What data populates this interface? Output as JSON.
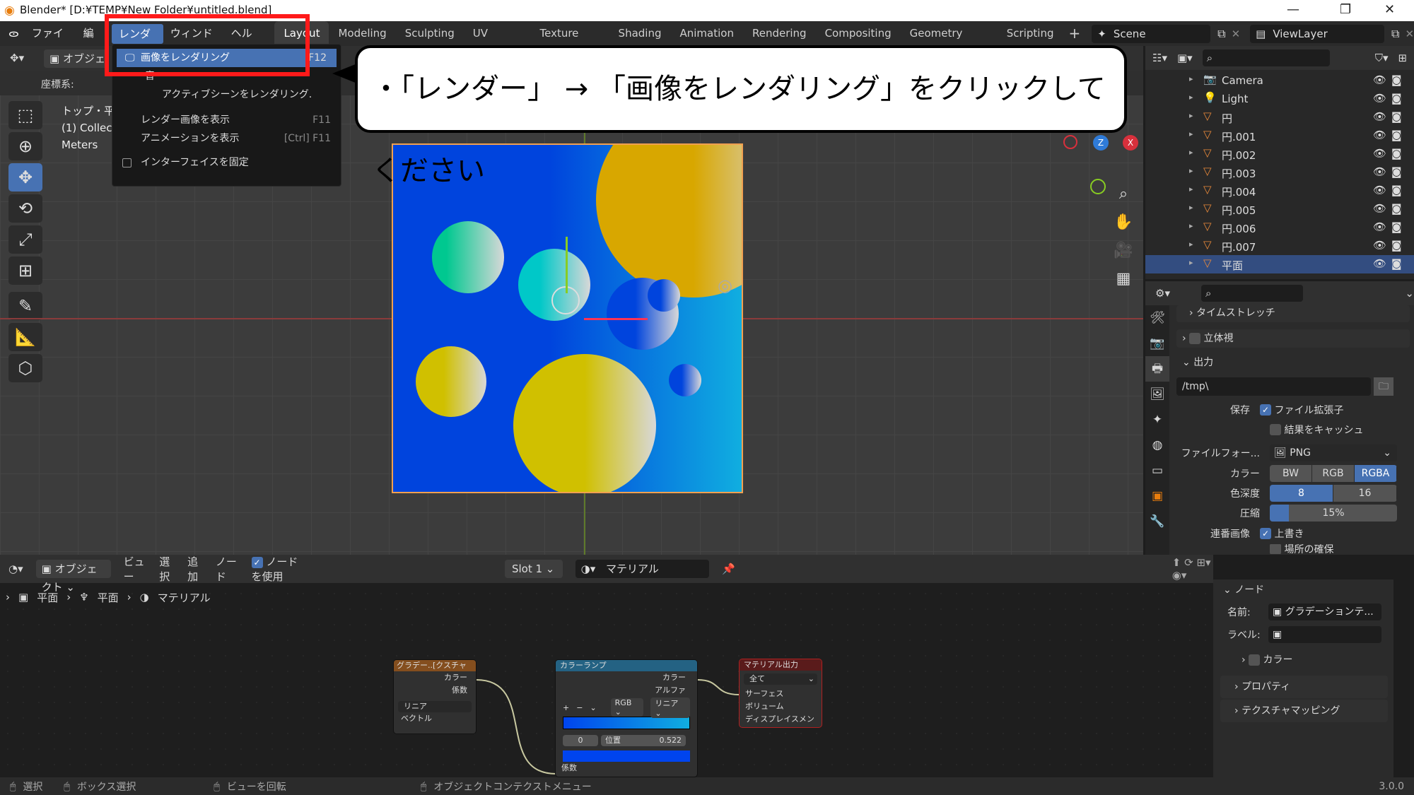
{
  "window": {
    "title": "Blender* [D:¥TEMP¥New Folder¥untitled.blend]"
  },
  "menubar": {
    "items": [
      "ファイル",
      "編集",
      "レンダー",
      "ウィンドウ",
      "ヘルプ"
    ]
  },
  "workspaces": [
    "Layout",
    "Modeling",
    "Sculpting",
    "UV Editing",
    "Texture Paint",
    "Shading",
    "Animation",
    "Rendering",
    "Compositing",
    "Geometry Nodes",
    "Scripting"
  ],
  "active_workspace": "Layout",
  "scene": "Scene",
  "view_layer": "ViewLayer",
  "render_menu": {
    "items": [
      {
        "label": "画像をレンダリング",
        "shortcut": "F12"
      },
      {
        "label": "アクティブシーンをレンダリング."
      },
      {
        "label": "レンダー画像を表示",
        "shortcut": "F11"
      },
      {
        "label": "アニメーションを表示",
        "shortcut": "[Ctrl] F11"
      },
      {
        "label": "インターフェイスを固定"
      }
    ],
    "partial": "音"
  },
  "callout": {
    "text": "・「レンダー」 → 「画像をレンダリング」をクリックしてください"
  },
  "viewport": {
    "header_mode": "オブジェ",
    "coord_label": "座標系:",
    "info": [
      "トップ・平",
      "(1) Collecti",
      "Meters"
    ],
    "colors": {
      "bg_plane_left": "#0044dd",
      "bg_plane_right": "#10aee0",
      "accent": "#4772b3"
    }
  },
  "outliner": {
    "items": [
      {
        "name": "Camera",
        "icon": "camera-icon"
      },
      {
        "name": "Light",
        "icon": "light-icon"
      },
      {
        "name": "円",
        "icon": "mesh-icon"
      },
      {
        "name": "円.001",
        "icon": "mesh-icon"
      },
      {
        "name": "円.002",
        "icon": "mesh-icon"
      },
      {
        "name": "円.003",
        "icon": "mesh-icon"
      },
      {
        "name": "円.004",
        "icon": "mesh-icon"
      },
      {
        "name": "円.005",
        "icon": "mesh-icon"
      },
      {
        "name": "円.006",
        "icon": "mesh-icon"
      },
      {
        "name": "円.007",
        "icon": "mesh-icon"
      },
      {
        "name": "平面",
        "icon": "mesh-icon",
        "selected": true
      }
    ]
  },
  "properties": {
    "sections": {
      "timestretch": "タイムストレッチ",
      "stereo": "立体視",
      "output": "出力"
    },
    "output_path": "/tmp\\",
    "save_label": "保存",
    "file_ext": "ファイル拡張子",
    "cache": "結果をキャッシュ",
    "file_format_label": "ファイルフォー...",
    "file_format": "PNG",
    "color_label": "カラー",
    "color_opts": [
      "BW",
      "RGB",
      "RGBA"
    ],
    "color_sel": "RGBA",
    "depth_label": "色深度",
    "depth_opts": [
      "8",
      "16"
    ],
    "depth_sel": "8",
    "compression_label": "圧縮",
    "compression": "15%",
    "compression_value": 0.15,
    "sequence_label": "連番画像",
    "overwrite": "上書き",
    "placeholder": "場所の確保"
  },
  "node_editor": {
    "header": {
      "mode": "オブジェクト",
      "menus": [
        "ビュー",
        "選択",
        "追加",
        "ノード"
      ],
      "use_nodes": "ノードを使用",
      "slot": "Slot 1",
      "material": "マテリアル"
    },
    "breadcrumb": [
      "平面",
      "平面",
      "マテリアル"
    ],
    "nodes": {
      "gradient": {
        "title": "グラデー..[クスチャ",
        "out": [
          "カラー",
          "係数"
        ],
        "mode": "リニア",
        "in": "ベクトル"
      },
      "ramp": {
        "title": "カラーランプ",
        "out": [
          "カラー",
          "アルファ"
        ],
        "mode": "RGB",
        "interp": "リニア",
        "index": "0",
        "pos_label": "位置",
        "pos": "0.522",
        "in": "係数"
      },
      "output": {
        "title": "マテリアル出力",
        "target": "全て",
        "in": [
          "サーフェス",
          "ボリューム",
          "ディスプレイスメン"
        ]
      }
    }
  },
  "npanel": {
    "node": "ノード",
    "name_label": "名前:",
    "name": "グラデーションテ...",
    "label_label": "ラベル:",
    "color": "カラー",
    "properties": "プロパティ",
    "texture_mapping": "テクスチャマッピング"
  },
  "status": {
    "select": "選択",
    "box_select": "ボックス選択",
    "rotate": "ビューを回転",
    "context_menu": "オブジェクトコンテクストメニュー",
    "version": "3.0.0"
  }
}
